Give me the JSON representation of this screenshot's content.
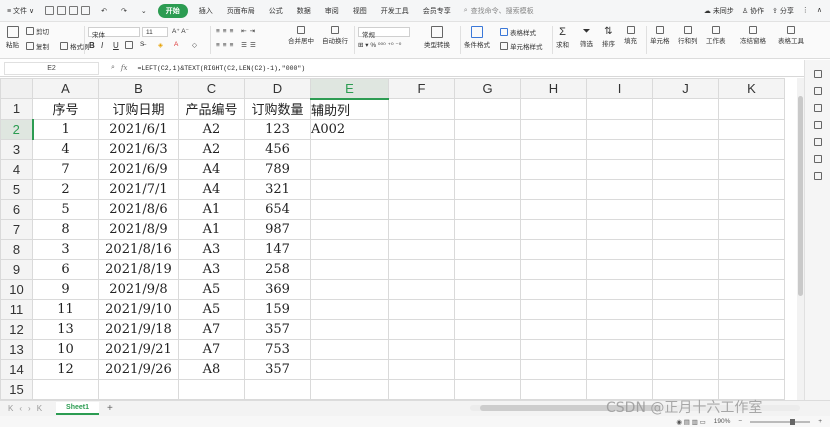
{
  "menubar": {
    "file": "文件",
    "start": "开始",
    "tabs": [
      "插入",
      "页面布局",
      "公式",
      "数据",
      "审阅",
      "视图",
      "开发工具",
      "会员专享"
    ],
    "search_placeholder": "查找命令、搜索模板",
    "sync": "未同步",
    "collab": "协作",
    "share": "分享"
  },
  "ribbon": {
    "paste": "粘贴",
    "cut": "剪切",
    "copy": "复制",
    "format_painter": "格式刷",
    "font_name": "宋体",
    "font_size": "11",
    "bold": "B",
    "italic": "I",
    "underline": "U",
    "merge_center": "合并居中",
    "wrap": "自动换行",
    "number_format": "常规",
    "type_convert": "类型转换",
    "cond_format": "条件格式",
    "table_style": "表格样式",
    "cell_style": "单元格样式",
    "sum": "求和",
    "filter": "筛选",
    "sort": "排序",
    "fill": "填充",
    "cell": "单元格",
    "row_col": "行和列",
    "worksheet": "工作表",
    "freeze": "冻结窗格",
    "table_tools": "表格工具"
  },
  "formula_bar": {
    "cell_ref": "E2",
    "formula": "=LEFT(C2,1)&TEXT(RIGHT(C2,LEN(C2)-1),\"000\")"
  },
  "sheet": {
    "columns": [
      "A",
      "B",
      "C",
      "D",
      "E",
      "F",
      "G",
      "H",
      "I",
      "J",
      "K"
    ],
    "selected_column": "E",
    "selected_row": 2,
    "rows": [
      [
        "序号",
        "订购日期",
        "产品编号",
        "订购数量",
        "辅助列"
      ],
      [
        "1",
        "2021/6/1",
        "A2",
        "123",
        "A002"
      ],
      [
        "4",
        "2021/6/3",
        "A2",
        "456",
        ""
      ],
      [
        "7",
        "2021/6/9",
        "A4",
        "789",
        ""
      ],
      [
        "2",
        "2021/7/1",
        "A4",
        "321",
        ""
      ],
      [
        "5",
        "2021/8/6",
        "A1",
        "654",
        ""
      ],
      [
        "8",
        "2021/8/9",
        "A1",
        "987",
        ""
      ],
      [
        "3",
        "2021/8/16",
        "A3",
        "147",
        ""
      ],
      [
        "6",
        "2021/8/19",
        "A3",
        "258",
        ""
      ],
      [
        "9",
        "2021/9/8",
        "A5",
        "369",
        ""
      ],
      [
        "11",
        "2021/9/10",
        "A5",
        "159",
        ""
      ],
      [
        "13",
        "2021/9/18",
        "A7",
        "357",
        ""
      ],
      [
        "10",
        "2021/9/21",
        "A7",
        "753",
        ""
      ],
      [
        "12",
        "2021/9/26",
        "A8",
        "357",
        ""
      ],
      [
        "",
        "",
        "",
        "",
        ""
      ]
    ]
  },
  "tabs": {
    "sheet_name": "Sheet1",
    "add": "+"
  },
  "status": {
    "zoom": "190%"
  },
  "watermark": "CSDN @正月十六工作室",
  "colors": {
    "accent": "#2c9c52"
  }
}
